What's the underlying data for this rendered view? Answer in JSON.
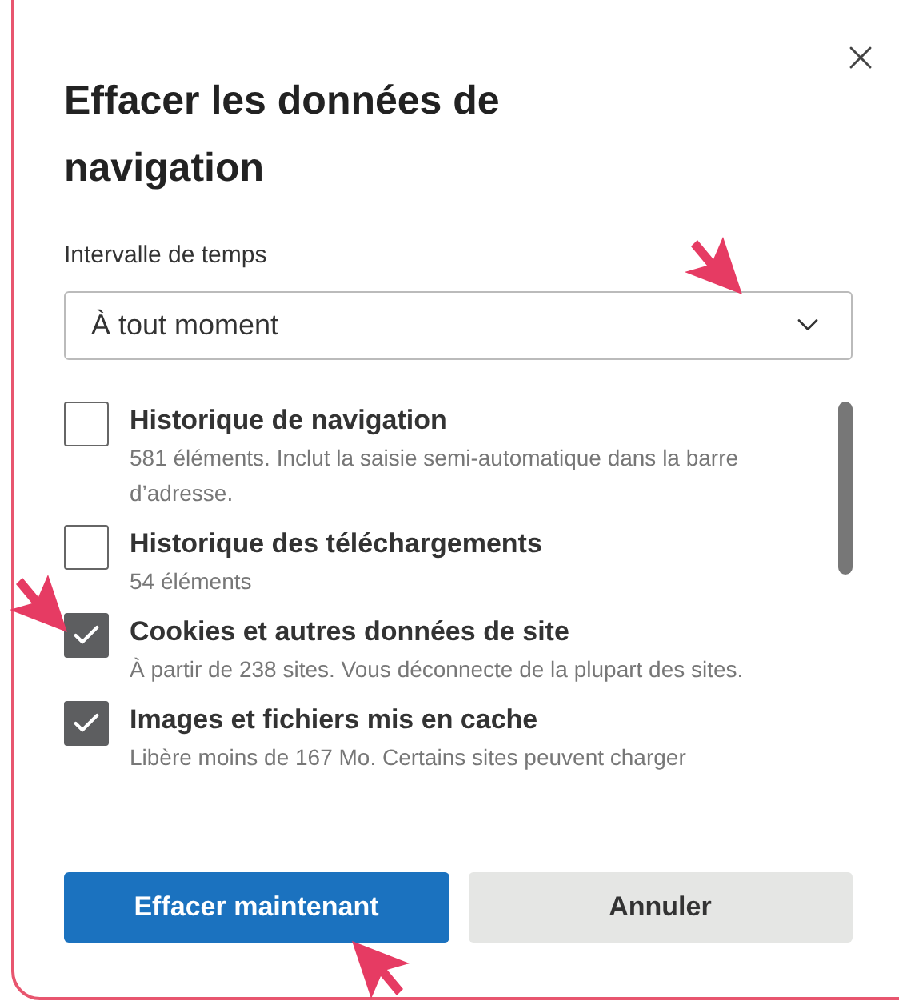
{
  "dialog": {
    "title": "Effacer les données de navigation",
    "time_range": {
      "label": "Intervalle de temps",
      "value": "À tout moment"
    },
    "items": [
      {
        "label": "Historique de navigation",
        "description": "581 éléments. Inclut la saisie semi-automatique dans la barre d’adresse.",
        "checked": false
      },
      {
        "label": "Historique des téléchargements",
        "description": "54 éléments",
        "checked": false
      },
      {
        "label": "Cookies et autres données de site",
        "description": "À partir de 238 sites. Vous déconnecte de la plupart des sites.",
        "checked": true
      },
      {
        "label": "Images et fichiers mis en cache",
        "description": "Libère moins de 167 Mo. Certains sites peuvent charger",
        "checked": true
      }
    ],
    "buttons": [
      {
        "label": "Effacer maintenant",
        "kind": "primary"
      },
      {
        "label": "Annuler",
        "kind": "secondary"
      }
    ]
  }
}
